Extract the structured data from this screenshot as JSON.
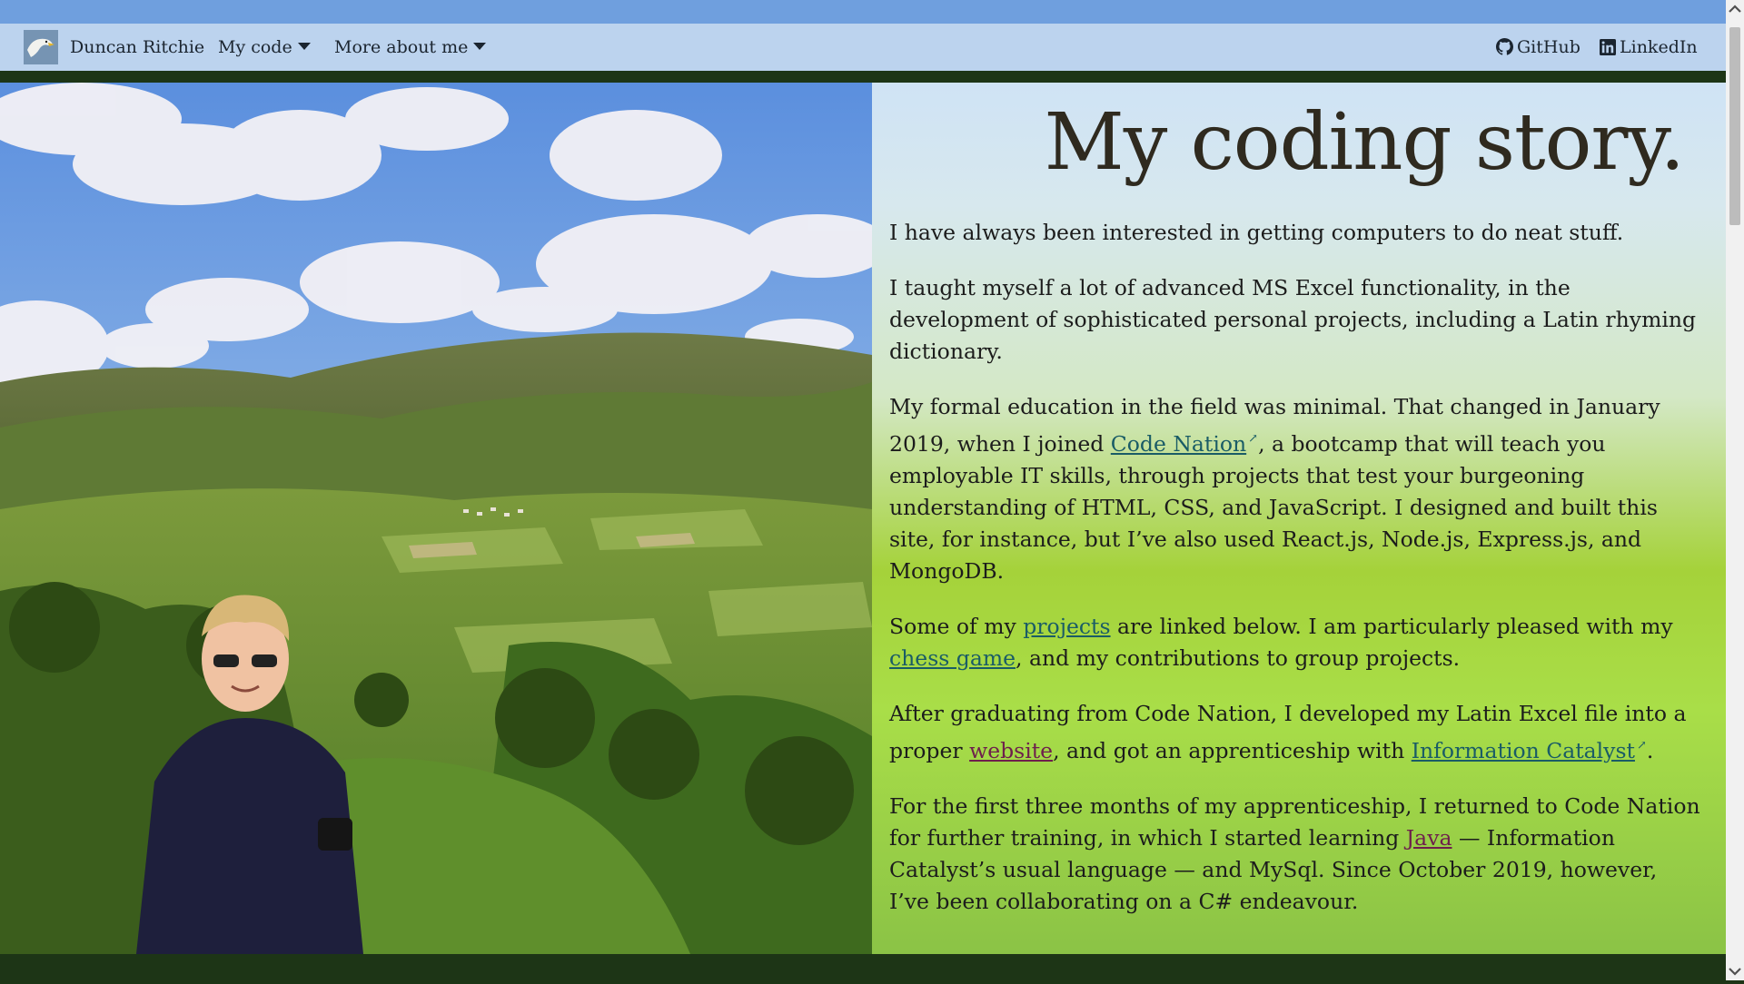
{
  "nav": {
    "brand_name": "Duncan Ritchie",
    "my_code": "My code",
    "more_about": "More about me",
    "github": "GitHub",
    "linkedin": "LinkedIn"
  },
  "story": {
    "title": "My coding story.",
    "p1": "I have always been interested in getting computers to do neat stuff.",
    "p2": "I taught myself a lot of advanced MS Excel functionality, in the development of sophisticated personal projects, including a Latin rhyming dictionary.",
    "p3_before": "My formal education in the field was minimal. That changed in January 2019, when I joined ",
    "p3_link": "Code Nation",
    "p3_after": ", a bootcamp that will teach you employable IT skills, through projects that test your burgeoning understanding of HTML, CSS, and JavaScript. I designed and built this site, for instance, but I’ve also used React.js, Node.js, Express.js, and MongoDB.",
    "p4_a": "Some of my ",
    "p4_link1": "projects",
    "p4_b": " are linked below. I am particularly pleased with my ",
    "p4_link2": "chess game",
    "p4_c": ", and my contributions to group projects.",
    "p5_a": "After graduating from Code Nation, I developed my Latin Excel file into a proper ",
    "p5_link1": "website",
    "p5_b": ", and got an apprenticeship with ",
    "p5_link2": "Information Catalyst",
    "p5_c": ".",
    "p6_a": "For the first three months of my apprenticeship, I returned to Code Nation for further training, in which I started learning ",
    "p6_link": "Java",
    "p6_b": " — Information Catalyst’s usual language — and MySql. Since October 2019, however, I’ve been collaborating on a C# endeavour."
  },
  "icons": {
    "external_link": "external-link-icon",
    "github": "github-icon",
    "linkedin": "linkedin-icon"
  },
  "colors": {
    "link": "#1a5c66",
    "visited_link": "#6e1f4c",
    "nav_bg": "#bcd3ee",
    "top_strip": "#6f9fde",
    "footer": "#1d3516"
  }
}
